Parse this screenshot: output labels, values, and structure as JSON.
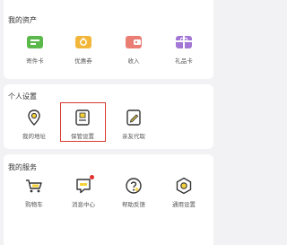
{
  "assets": {
    "title": "我的资产",
    "items": [
      {
        "label": "寄件卡",
        "icon": "card-icon",
        "color": "#5bb94c"
      },
      {
        "label": "优惠券",
        "icon": "coupon-icon",
        "color": "#f2b63b"
      },
      {
        "label": "收入",
        "icon": "wallet-icon",
        "color": "#ea7d74"
      },
      {
        "label": "礼品卡",
        "icon": "gift-card-icon",
        "color": "#a477d6"
      }
    ]
  },
  "personal": {
    "title": "个人设置",
    "items": [
      {
        "label": "我的地址",
        "icon": "location-pin-icon"
      },
      {
        "label": "保管设置",
        "icon": "storage-box-icon"
      },
      {
        "label": "亲友代取",
        "icon": "proxy-pickup-icon"
      }
    ]
  },
  "services": {
    "title": "我的服务",
    "items": [
      {
        "label": "购物车",
        "icon": "cart-icon"
      },
      {
        "label": "消息中心",
        "icon": "message-icon"
      },
      {
        "label": "帮助反馈",
        "icon": "help-icon"
      },
      {
        "label": "通用设置",
        "icon": "settings-icon"
      }
    ]
  },
  "colors": {
    "accent": "#d83a2e",
    "icon_outline": "#333333",
    "icon_fill": "#f5d23a"
  }
}
